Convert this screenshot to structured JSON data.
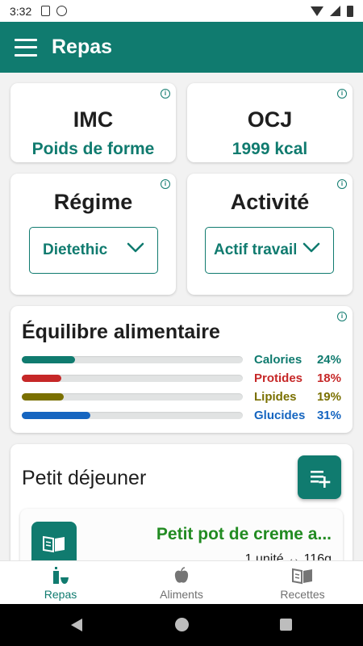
{
  "status_bar": {
    "time": "3:32"
  },
  "app_bar": {
    "title": "Repas"
  },
  "imc": {
    "title": "IMC",
    "value": "Poids de forme"
  },
  "ocj": {
    "title": "OCJ",
    "value": "1999 kcal"
  },
  "regime": {
    "title": "Régime",
    "selected": "Dietethic"
  },
  "activite": {
    "title": "Activité",
    "selected": "Actif travail"
  },
  "equilibre": {
    "title": "Équilibre alimentaire",
    "rows": [
      {
        "label": "Calories",
        "percent_text": "24%",
        "fraction": 0.24,
        "color": "#107b6f"
      },
      {
        "label": "Protides",
        "percent_text": "18%",
        "fraction": 0.18,
        "color": "#c62828"
      },
      {
        "label": "Lipides",
        "percent_text": "19%",
        "fraction": 0.19,
        "color": "#7a7000"
      },
      {
        "label": "Glucides",
        "percent_text": "31%",
        "fraction": 0.31,
        "color": "#1565c0"
      }
    ]
  },
  "meal": {
    "title": "Petit déjeuner",
    "item": {
      "name": "Petit pot de creme a...",
      "quantity": "1 unité ↔ 116g"
    }
  },
  "bottom_nav": {
    "items": [
      {
        "label": "Repas",
        "icon": "repas-icon",
        "active": true
      },
      {
        "label": "Aliments",
        "icon": "apple-icon",
        "active": false
      },
      {
        "label": "Recettes",
        "icon": "book-icon",
        "active": false
      }
    ]
  },
  "colors": {
    "primary": "#107b6f",
    "background": "#f2f2f2"
  }
}
